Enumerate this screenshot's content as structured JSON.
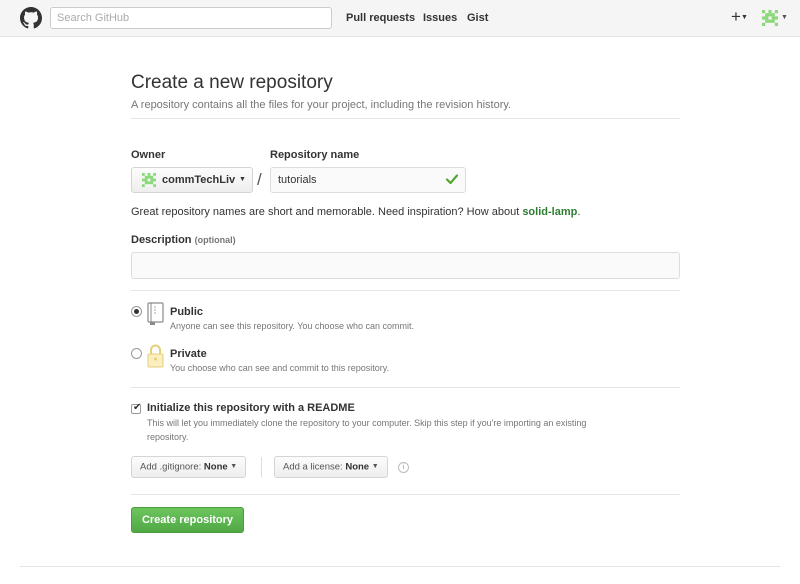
{
  "header": {
    "search_placeholder": "Search GitHub",
    "nav": [
      "Pull requests",
      "Issues",
      "Gist"
    ],
    "plus_icon": "+"
  },
  "page": {
    "title": "Create a new repository",
    "subtitle": "A repository contains all the files for your project, including the revision history."
  },
  "form": {
    "owner_label": "Owner",
    "owner_value": "commTechLiv",
    "slash": "/",
    "repo_label": "Repository name",
    "repo_value": "tutorials",
    "hint_text": "Great repository names are short and memorable. Need inspiration? How about ",
    "hint_suggestion": "solid-lamp",
    "hint_end": ".",
    "description_label": "Description",
    "description_optional": "(optional)",
    "description_value": "",
    "visibility": [
      {
        "title": "Public",
        "note": "Anyone can see this repository. You choose who can commit.",
        "selected": true
      },
      {
        "title": "Private",
        "note": "You choose who can see and commit to this repository.",
        "selected": false
      }
    ],
    "readme_label": "Initialize this repository with a README",
    "readme_note_1": "This will let you immediately clone the repository to your computer. Skip this step if you're importing an existing",
    "readme_note_2": "repository.",
    "readme_checked": true,
    "gitignore_label": "Add .gitignore:",
    "gitignore_value": "None",
    "license_label": "Add a license:",
    "license_value": "None",
    "info_icon": "i",
    "create_button": "Create repository"
  },
  "colors": {
    "accent_green": "#55a532",
    "suggestion_green": "#2e7d32",
    "header_bg": "#f5f5f5"
  },
  "icons": [
    "github-logo-icon",
    "plus-icon",
    "avatar-icon",
    "check-icon",
    "book-icon",
    "lock-icon",
    "info-icon"
  ]
}
